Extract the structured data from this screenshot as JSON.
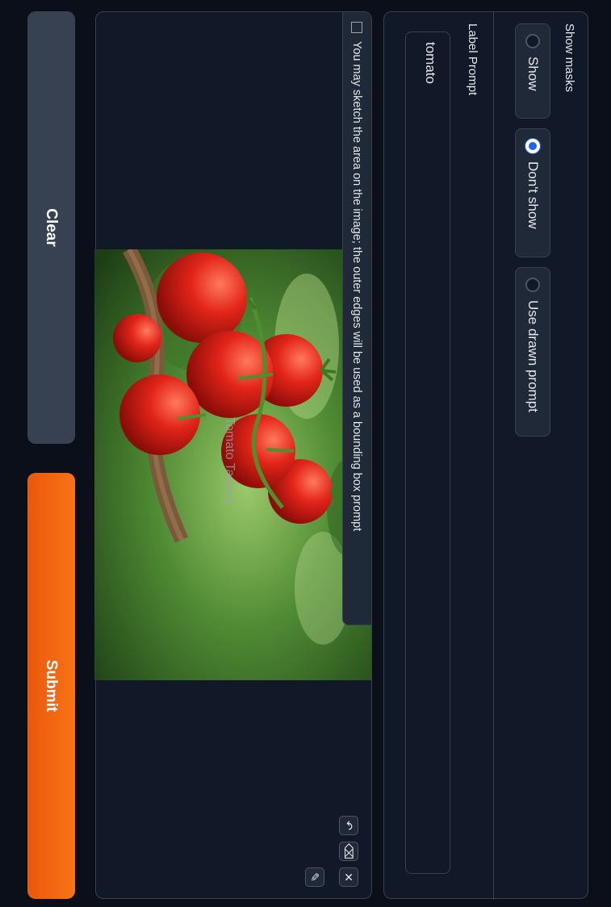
{
  "options": {
    "show_masks_label": "Show masks",
    "masks_options": [
      {
        "label": "Show",
        "selected": false
      },
      {
        "label": "Don't show",
        "selected": true
      },
      {
        "label": "Use drawn prompt",
        "selected": false
      }
    ],
    "label_prompt_label": "Label Prompt",
    "label_prompt_value": "tomato"
  },
  "editor": {
    "hint_text": "You may sketch the area on the image; the outer edges will be used as a bounding box prompt",
    "watermark_text": "Tomato Tasting",
    "tools": [
      "close-icon",
      "brush-icon",
      "eraser-icon",
      "undo-icon"
    ]
  },
  "buttons": {
    "clear_label": "Clear",
    "submit_label": "Submit"
  },
  "colors": {
    "background": "#0b0f19",
    "panel": "#111827",
    "accent_submit": "#f97316",
    "radio_selected": "#2563eb"
  }
}
